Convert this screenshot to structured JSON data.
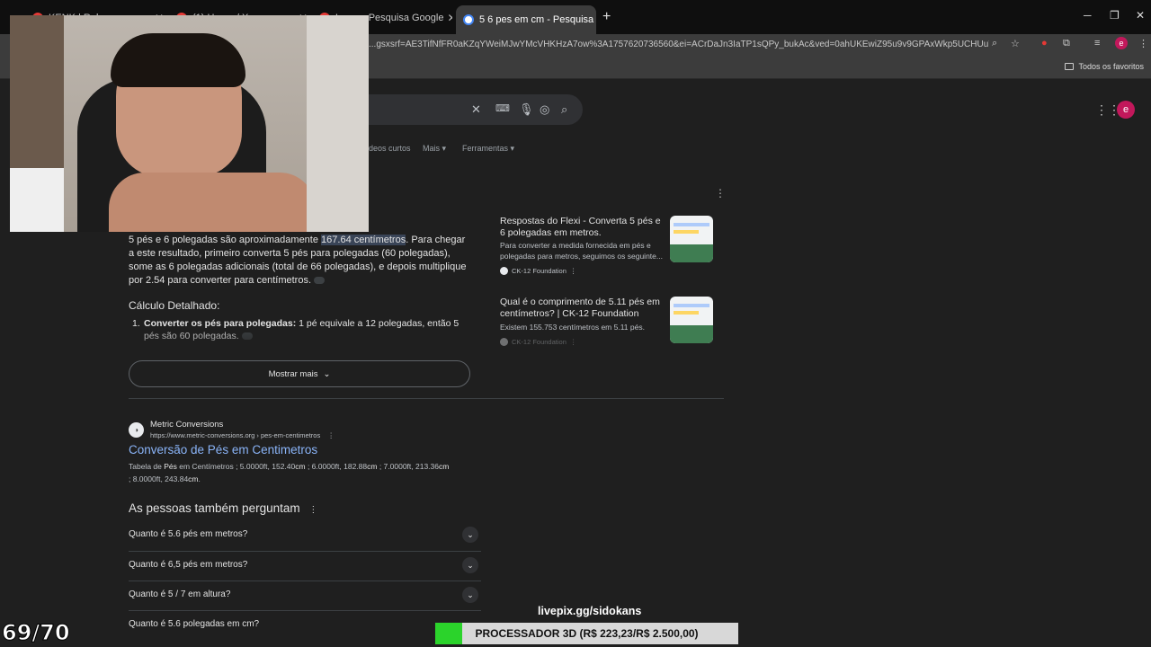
{
  "tabs": [
    {
      "label": "KENK | Rol..."
    },
    {
      "label": "(1) Home / X"
    },
    {
      "label": "Long... Pesquisa Google"
    },
    {
      "label": "5 6 pes em cm - Pesquisa Googl",
      "active": true
    }
  ],
  "toolbar": {
    "url": "...gsxsrf=AE3TifNfFR0aKZqYWeiMJwYMcVHKHzA7ow%3A1757620736560&ei=ACrDaJn3IaTP1sQPy_bukAc&ved=0ahUKEwiZ95u9v9GPAxWkp5UCHUu7G3IQ4dUDCBA...",
    "bookmarks_folder": "Todos os favoritos",
    "profile_initial": "e"
  },
  "google": {
    "nav_tabs": [
      "deos curtos",
      "Mais",
      "Ferramentas"
    ],
    "avatar_initial": "e"
  },
  "ai_overview": {
    "answer_pre": "5 pés e 6 polegadas são aproximadamente ",
    "answer_highlight": "167.64 centímetros",
    "answer_post": ". Para chegar a este resultado, primeiro converta 5 pés para polegadas (60 polegadas), some as 6 polegadas adicionais (total de 66 polegadas), e depois multiplique por 2.54 para converter para centímetros.",
    "calc_title": "Cálculo Detalhado:",
    "step1_num": "1.",
    "step1_bold": "Converter os pés para polegadas:",
    "step1_text": " 1 pé equivale a 12 polegadas, então 5 pés são 60 polegadas.",
    "show_more": "Mostrar mais"
  },
  "side_cards": [
    {
      "title": "Respostas do Flexi - Converta 5 pés e 6 polegadas em metros.",
      "desc": "Para converter a medida fornecida em pés e polegadas para metros, seguimos os seguinte...",
      "source": "CK-12 Foundation"
    },
    {
      "title": "Qual é o comprimento de 5.11 pés em centímetros? | CK-12 Foundation",
      "desc": "Existem 155.753 centímetros em 5.11 pés.",
      "source": "CK-12 Foundation"
    }
  ],
  "result": {
    "site_name": "Metric Conversions",
    "site_url": "https://www.metric-conversions.org › pes-em-centimetros",
    "title": "Conversão de Pés em Centimetros",
    "snippet_1": "Tabela de ",
    "snippet_b1": "Pés",
    "snippet_2": " em Centímetros ; 5.0000ft, 152.40",
    "snippet_b2": "cm",
    "snippet_3": " ; 6.0000ft, 182.88",
    "snippet_b3": "cm",
    "snippet_4": " ; 7.0000ft, 213.36",
    "snippet_b4": "cm",
    "snippet_5": " ; 8.0000ft, 243.84",
    "snippet_b5": "cm",
    "snippet_6": "."
  },
  "paa": {
    "title": "As pessoas também perguntam",
    "questions": [
      "Quanto é 5.6 pés em metros?",
      "Quanto é 6,5 pés em metros?",
      "Quanto é 5 / 7 em altura?",
      "Quanto é 5.6 polegadas em cm?"
    ]
  },
  "stream": {
    "counter": "69/70",
    "livepix": "livepix.gg/sidokans",
    "goal_text": "PROCESSADOR 3D (R$ 223,23/R$ 2.500,00)",
    "goal_progress": 0.089
  },
  "colors": {
    "link": "#8ab4f8",
    "highlight": "#394457",
    "goal_fill": "#2bd32b"
  }
}
